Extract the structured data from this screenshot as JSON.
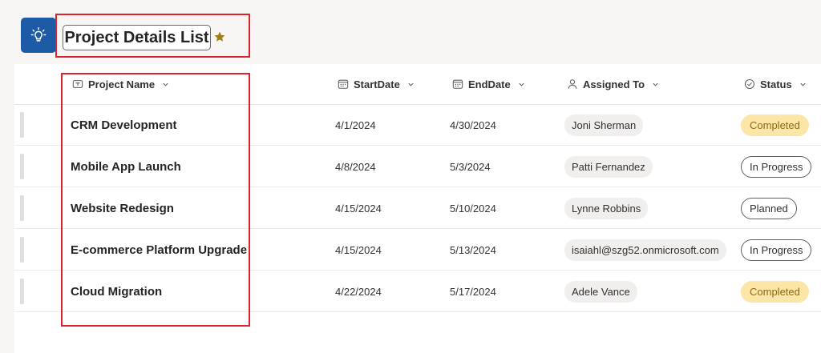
{
  "header": {
    "title": "Project Details List",
    "app_icon": "lightbulb-icon",
    "favorite_icon": "star-icon",
    "accent_color": "#1d5ba6",
    "star_color": "#a27f16"
  },
  "columns": [
    {
      "key": "name",
      "label": "Project Name",
      "icon": "text-field-icon"
    },
    {
      "key": "start",
      "label": "StartDate",
      "icon": "calendar-icon"
    },
    {
      "key": "end",
      "label": "EndDate",
      "icon": "calendar-icon"
    },
    {
      "key": "assigned",
      "label": "Assigned To",
      "icon": "person-icon"
    },
    {
      "key": "status",
      "label": "Status",
      "icon": "status-check-icon"
    }
  ],
  "rows": [
    {
      "name": "CRM Development",
      "start": "4/1/2024",
      "end": "4/30/2024",
      "assigned": "Joni Sherman",
      "status": "Completed"
    },
    {
      "name": "Mobile App Launch",
      "start": "4/8/2024",
      "end": "5/3/2024",
      "assigned": "Patti Fernandez",
      "status": "In Progress"
    },
    {
      "name": "Website Redesign",
      "start": "4/15/2024",
      "end": "5/10/2024",
      "assigned": "Lynne Robbins",
      "status": "Planned"
    },
    {
      "name": "E-commerce Platform Upgrade",
      "start": "4/15/2024",
      "end": "5/13/2024",
      "assigned": "isaiahl@szg52.onmicrosoft.com",
      "status": "In Progress"
    },
    {
      "name": "Cloud Migration",
      "start": "4/22/2024",
      "end": "5/17/2024",
      "assigned": "Adele Vance",
      "status": "Completed"
    }
  ],
  "status_colors": {
    "Completed": "#fbe6a8",
    "In Progress": "#ffffff",
    "Planned": "#ffffff"
  }
}
